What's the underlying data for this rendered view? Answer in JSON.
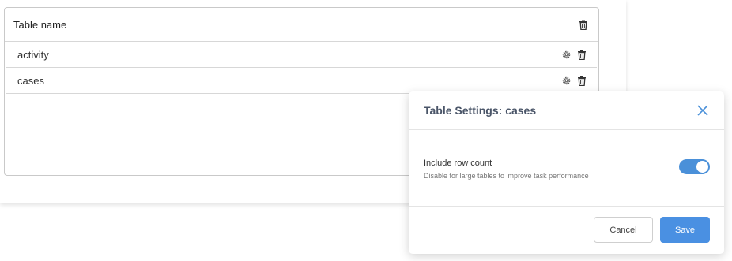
{
  "table": {
    "header_title": "Table name",
    "rows": [
      {
        "label": "activity"
      },
      {
        "label": "cases"
      }
    ]
  },
  "dialog": {
    "title": "Table Settings: cases",
    "setting": {
      "label": "Include row count",
      "help": "Disable for large tables to improve task performance",
      "enabled": true
    },
    "cancel_label": "Cancel",
    "save_label": "Save"
  },
  "icons": {
    "delete": "trash-icon",
    "settings": "gear-icon",
    "close": "close-icon"
  },
  "colors": {
    "accent": "#4a90e2",
    "toggle_on": "#4a90d9",
    "close_icon": "#4a90d9",
    "dialog_title": "#4a5568"
  }
}
